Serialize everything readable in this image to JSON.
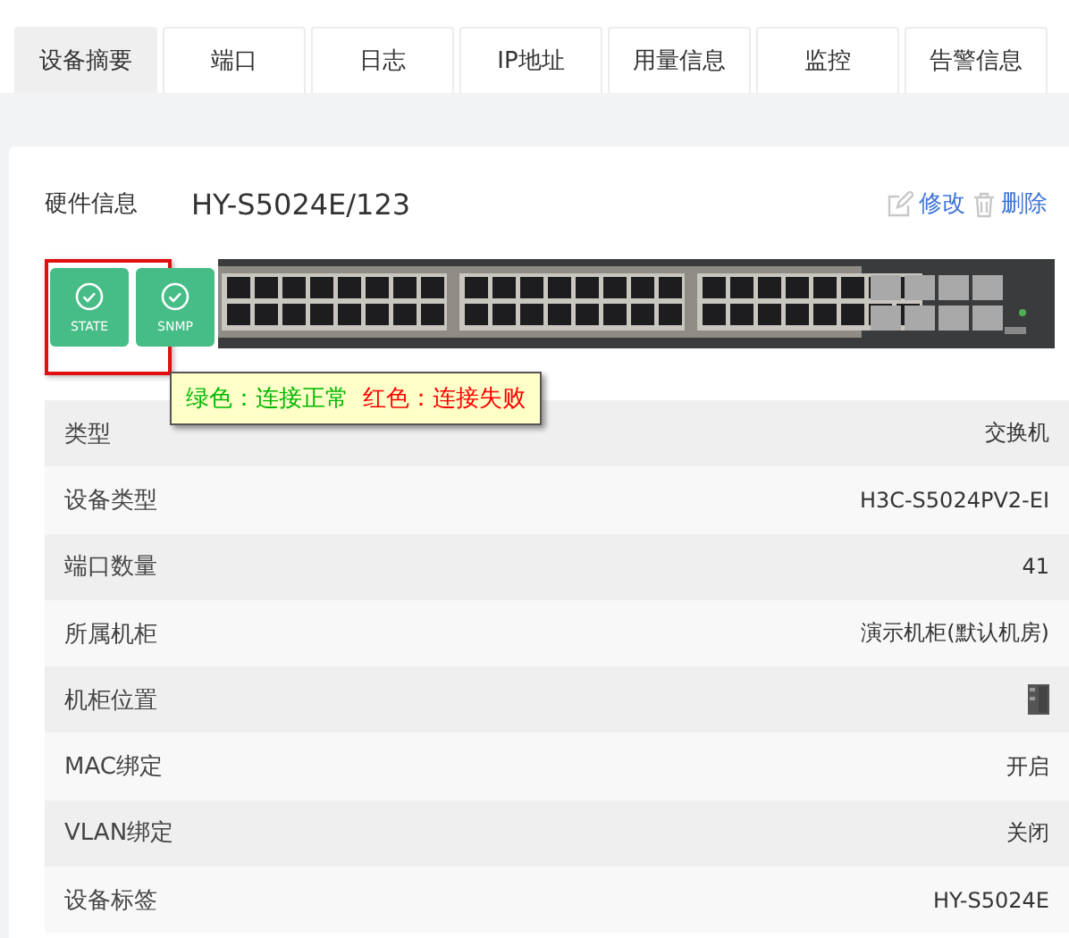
{
  "tabs": [
    {
      "label": "设备摘要",
      "selected": true
    },
    {
      "label": "端口",
      "selected": false
    },
    {
      "label": "日志",
      "selected": false
    },
    {
      "label": "IP地址",
      "selected": false
    },
    {
      "label": "用量信息",
      "selected": false
    },
    {
      "label": "监控",
      "selected": false
    },
    {
      "label": "告警信息",
      "selected": false
    }
  ],
  "header": {
    "label": "硬件信息",
    "device_name": "HY-S5024E/123",
    "actions": [
      {
        "kind": "edit",
        "label": "修改"
      },
      {
        "kind": "delete",
        "label": "删除"
      }
    ]
  },
  "status_buttons": [
    {
      "label": "STATE",
      "highlighted": true
    },
    {
      "label": "SNMP",
      "highlighted": false
    }
  ],
  "tooltip": {
    "parts": [
      {
        "text": "绿色：连接正常",
        "color": "#00b800"
      },
      {
        "text": "红色：连接失败",
        "color": "#ff0000"
      }
    ]
  },
  "properties": [
    {
      "label": "类型",
      "kind": "text",
      "value": "交换机"
    },
    {
      "label": "设备类型",
      "kind": "text",
      "value": "H3C-S5024PV2-EI"
    },
    {
      "label": "端口数量",
      "kind": "text",
      "value": "41"
    },
    {
      "label": "所属机柜",
      "kind": "text",
      "value": "演示机柜(默认机房)"
    },
    {
      "label": "机柜位置",
      "kind": "icon"
    },
    {
      "label": "MAC绑定",
      "kind": "text",
      "value": "开启"
    },
    {
      "label": "VLAN绑定",
      "kind": "text",
      "value": "关闭"
    },
    {
      "label": "设备标签",
      "kind": "text",
      "value": "HY-S5024E"
    }
  ]
}
